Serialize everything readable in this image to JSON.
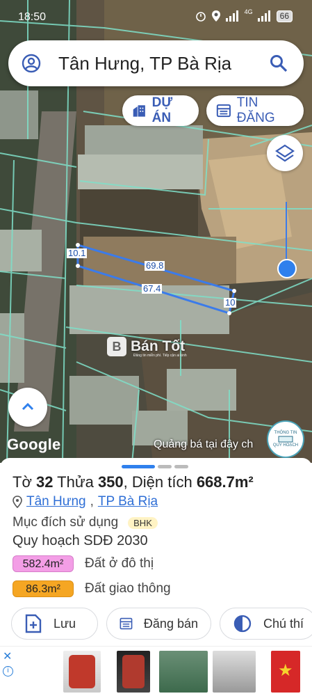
{
  "status_bar": {
    "time": "18:50",
    "battery": "66",
    "signal_label": "4G"
  },
  "search": {
    "query": "Tân Hưng, TP Bà Rịa"
  },
  "chips": {
    "du_an": "DỰ ÁN",
    "tin_dang": "TIN ĐĂNG"
  },
  "map": {
    "dimensions": [
      "10.1",
      "69.8",
      "67.4",
      "10"
    ],
    "google_logo": "Google",
    "ad_label": "Quảng bá tại đây ch",
    "badge": {
      "line1": "THÔNG TIN",
      "line2": "QUY HOẠCH"
    },
    "watermark": {
      "logo": "B",
      "text": "Bán Tốt",
      "sub": "Đăng tin miễn phí. Tiếp cận ai kinh"
    }
  },
  "parcel": {
    "prefix_to": "Tờ ",
    "to": "32",
    "prefix_thua": " Thửa ",
    "thua": "350",
    "prefix_area": ", Diện tích ",
    "area": "668.7m²",
    "ward": "Tân Hưng",
    "separator": ", ",
    "city": "TP Bà Rịa",
    "purpose_label": "Mục đích sử dụng",
    "purpose_code": "BHK",
    "plan_title": "Quy hoạch SDĐ 2030",
    "legend": [
      {
        "value": "582.4m²",
        "label": "Đất ở đô thị",
        "color": "#f39ee6"
      },
      {
        "value": "86.3m²",
        "label": "Đất giao thông",
        "color": "#f5a623"
      }
    ]
  },
  "actions": {
    "save": "Lưu",
    "post": "Đăng bán",
    "note": "Chú thí"
  },
  "colors": {
    "accent": "#2f80ed",
    "brand_blue": "#3a5db5"
  }
}
